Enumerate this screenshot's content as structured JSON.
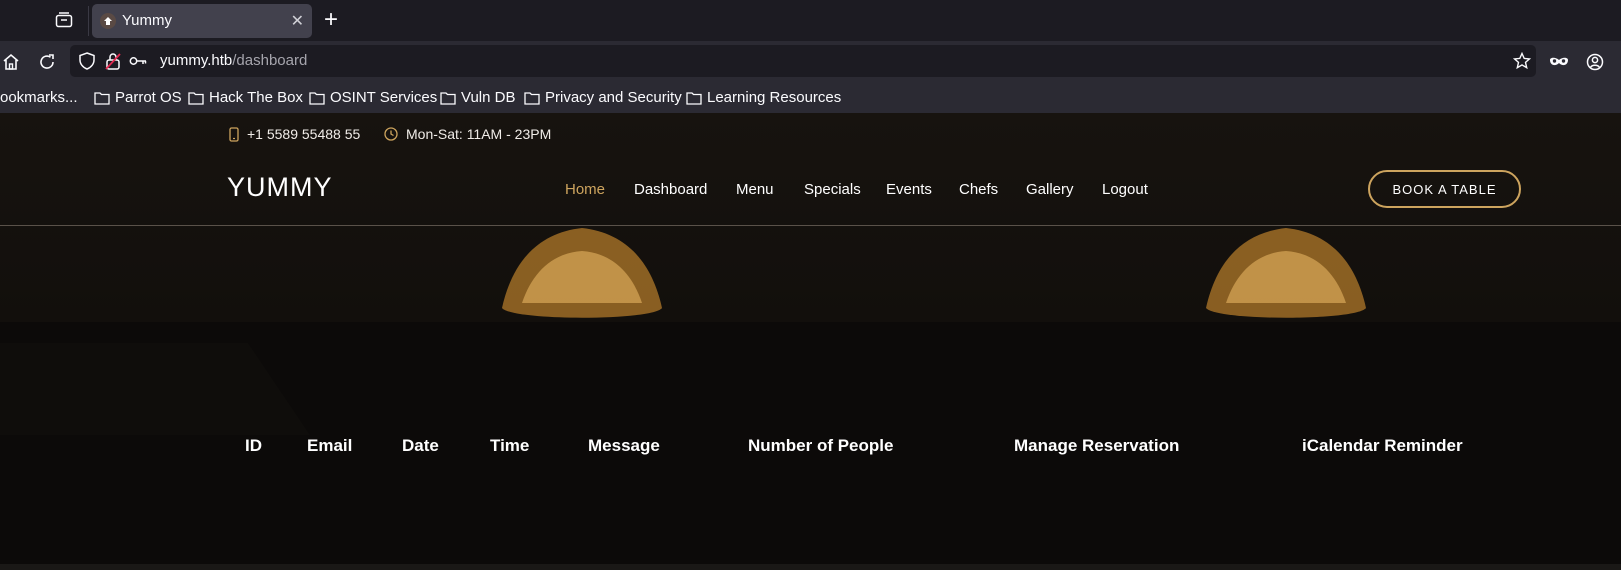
{
  "browser": {
    "tab": {
      "title": "Yummy"
    },
    "address_bar": {
      "host": "yummy.htb",
      "path": "/dashboard"
    },
    "bookmarks": [
      "ookmarks...",
      "Parrot OS",
      "Hack The Box",
      "OSINT Services",
      "Vuln DB",
      "Privacy and Security",
      "Learning Resources"
    ]
  },
  "site": {
    "contact": {
      "phone": "+1 5589 55488 55",
      "hours": "Mon-Sat: 11AM - 23PM"
    },
    "logo": "YUMMY",
    "menu": [
      "Home",
      "Dashboard",
      "Menu",
      "Specials",
      "Events",
      "Chefs",
      "Gallery",
      "Logout"
    ],
    "active_menu": "Home",
    "book_button": "BOOK A TABLE"
  },
  "table": {
    "headers": [
      "ID",
      "Email",
      "Date",
      "Time",
      "Message",
      "Number of People",
      "Manage Reservation",
      "iCalendar Reminder"
    ],
    "rows": []
  },
  "colors": {
    "accent": "#cda45e",
    "page_background": "#0c0a09",
    "browser_toolbar": "#2b2a33",
    "tab_strip": "#1c1b22"
  }
}
